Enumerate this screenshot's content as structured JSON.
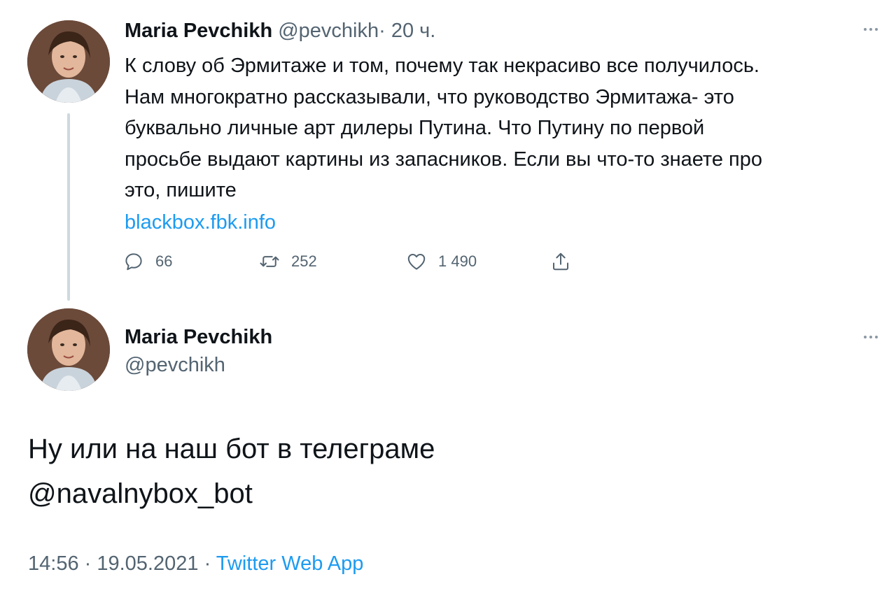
{
  "parent_tweet": {
    "author_name": "Maria Pevchikh",
    "author_handle": "@pevchikh",
    "separator": "·",
    "time": "20 ч.",
    "text": "К слову об Эрмитаже и том, почему так некрасиво все получилось.\nНам многократно рассказывали, что руководство Эрмитажа- это\nбуквально личные арт дилеры Путина. Что Путину по первой\nпросьбе выдают картины из запасников. Если вы что-то знаете про\nэто, пишите",
    "link": "blackbox.fbk.info",
    "actions": {
      "reply_icon": "reply-icon",
      "reply_count": "66",
      "retweet_icon": "retweet-icon",
      "retweet_count": "252",
      "like_icon": "heart-icon",
      "like_count": "1 490",
      "share_icon": "share-icon"
    }
  },
  "main_tweet": {
    "author_name": "Maria Pevchikh",
    "author_handle": "@pevchikh",
    "text": "Ну или на наш бот в телеграме\n@navalnybox_bot",
    "time": "14:56",
    "separator_1": " · ",
    "date": "19.05.2021",
    "separator_2": " · ",
    "source": "Twitter Web App"
  },
  "colors": {
    "text": "#0f1419",
    "secondary": "#536471",
    "link": "#1d9bf0",
    "thread_line": "#cfd9de"
  }
}
